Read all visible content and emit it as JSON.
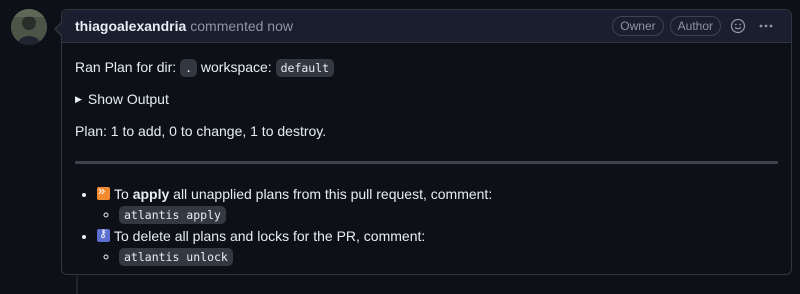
{
  "comment": {
    "author": "thiagoalexandria",
    "action": "commented now",
    "badges": [
      "Owner",
      "Author"
    ],
    "icons": {
      "reaction": "smiley-icon",
      "more": "kebab-horizontal-icon"
    }
  },
  "body": {
    "ran_plan_prefix": "Ran Plan for dir:",
    "dir_code": ".",
    "workspace_label": "workspace:",
    "workspace_code": "default",
    "show_output": "Show Output",
    "plan_summary": "Plan: 1 to add, 0 to change, 1 to destroy."
  },
  "instructions": [
    {
      "emoji": "fast-forward-icon",
      "text_before": "To ",
      "bold": "apply",
      "text_after": " all unapplied plans from this pull request, comment:",
      "command": "atlantis apply"
    },
    {
      "emoji": "unlock-icon",
      "text_before": "To delete all plans and locks for the PR, comment:",
      "command": "atlantis unlock"
    }
  ],
  "colors": {
    "background": "#0d1117",
    "header": "#1a1e2e",
    "border": "#30363d",
    "muted": "#8d96a0"
  }
}
